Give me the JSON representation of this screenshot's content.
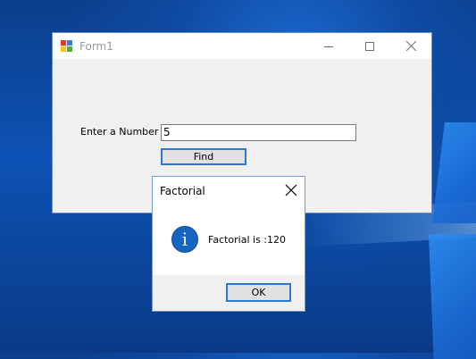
{
  "form1": {
    "title": "Form1",
    "label": "Enter a Number :",
    "input_value": "5",
    "find_label": "Find"
  },
  "messagebox": {
    "title": "Factorial",
    "message": "Factorial is :120",
    "ok_label": "OK",
    "icon": "information-icon"
  },
  "icons": {
    "app": "form-app-icon",
    "minimize": "minimize-icon",
    "maximize": "maximize-icon",
    "close": "close-icon"
  },
  "colors": {
    "accent_border": "#2a78d1",
    "info_icon": "#1565c0",
    "desktop": "#0d52b5"
  }
}
